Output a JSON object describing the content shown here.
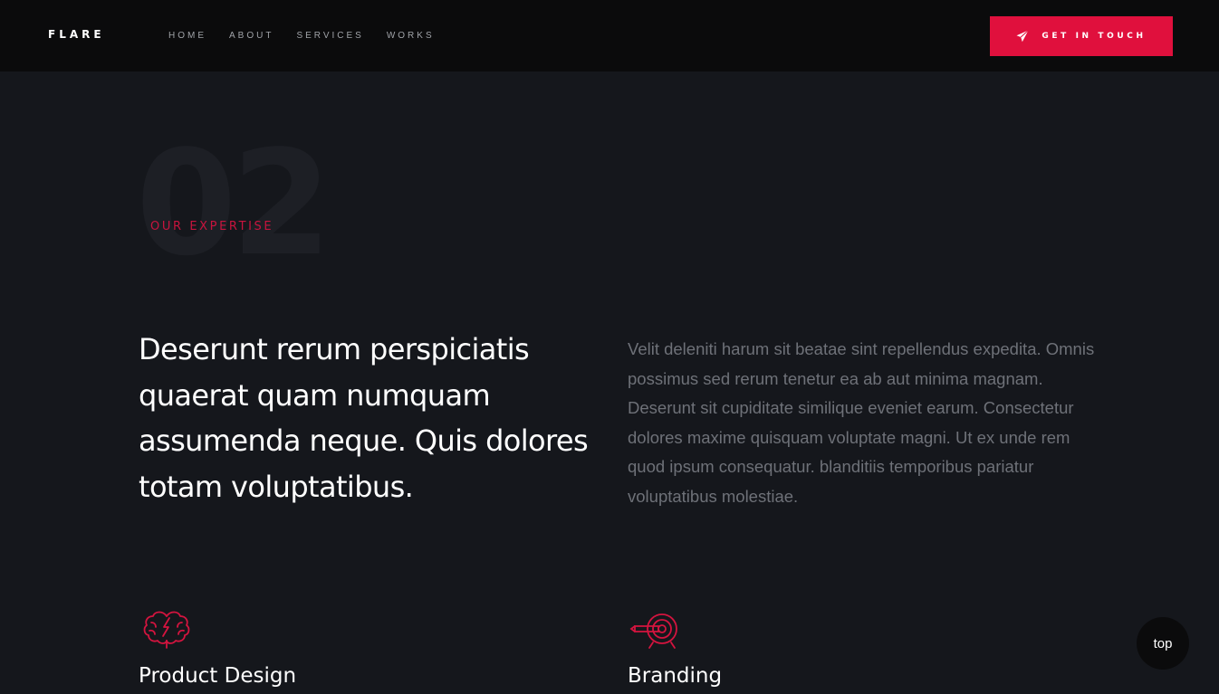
{
  "header": {
    "logo": "FLARE",
    "nav": [
      "HOME",
      "ABOUT",
      "SERVICES",
      "WORKS"
    ],
    "cta_label": "GET IN TOUCH",
    "cta_icon": "paper-plane-icon"
  },
  "section": {
    "number": "02",
    "eyebrow": "OUR EXPERTISE",
    "lead": "Deserunt rerum perspiciatis quaerat quam numquam assumenda neque. Quis dolores totam voluptatibus.",
    "description": "Velit deleniti harum sit beatae sint repellendus expedita. Omnis possimus sed rerum tenetur ea ab aut minima magnam. Deserunt sit cupiditate similique eveniet earum. Consectetur dolores maxime quisquam voluptate magni. Ut ex unde rem quod ipsum consequatur. blanditiis temporibus pariatur voluptatibus molestiae."
  },
  "services": [
    {
      "title": "Product Design",
      "icon": "brain-icon"
    },
    {
      "title": "Branding",
      "icon": "target-icon"
    }
  ],
  "back_to_top": "top",
  "colors": {
    "accent": "#e0103d",
    "background": "#15171c",
    "header_bg": "#0b0b0c"
  }
}
